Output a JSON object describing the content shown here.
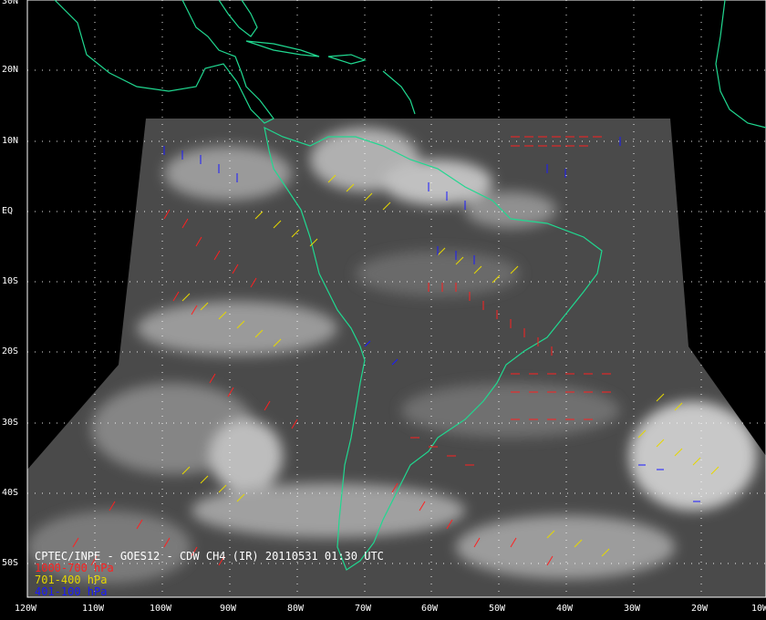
{
  "product": {
    "caption": "CPTEC/INPE - GOES12 - CDW CH4 (IR) 20110531 01:30 UTC"
  },
  "legend": [
    {
      "label": "1000-700 hPa",
      "color": "#ff2020"
    },
    {
      "label": "701-400 hPa",
      "color": "#e6d800"
    },
    {
      "label": "401-100 hPa",
      "color": "#1a1aff"
    }
  ],
  "grid": {
    "lat_labels": [
      "30N",
      "20N",
      "10N",
      "EQ",
      "10S",
      "20S",
      "30S",
      "40S",
      "50S"
    ],
    "lon_labels": [
      "120W",
      "110W",
      "100W",
      "90W",
      "80W",
      "70W",
      "60W",
      "50W",
      "40W",
      "30W",
      "20W",
      "10W"
    ],
    "color": "#ffffff",
    "style": "dotted"
  },
  "colors": {
    "coastline": "#20d890",
    "background": "#000000",
    "imagery": "#555555"
  }
}
